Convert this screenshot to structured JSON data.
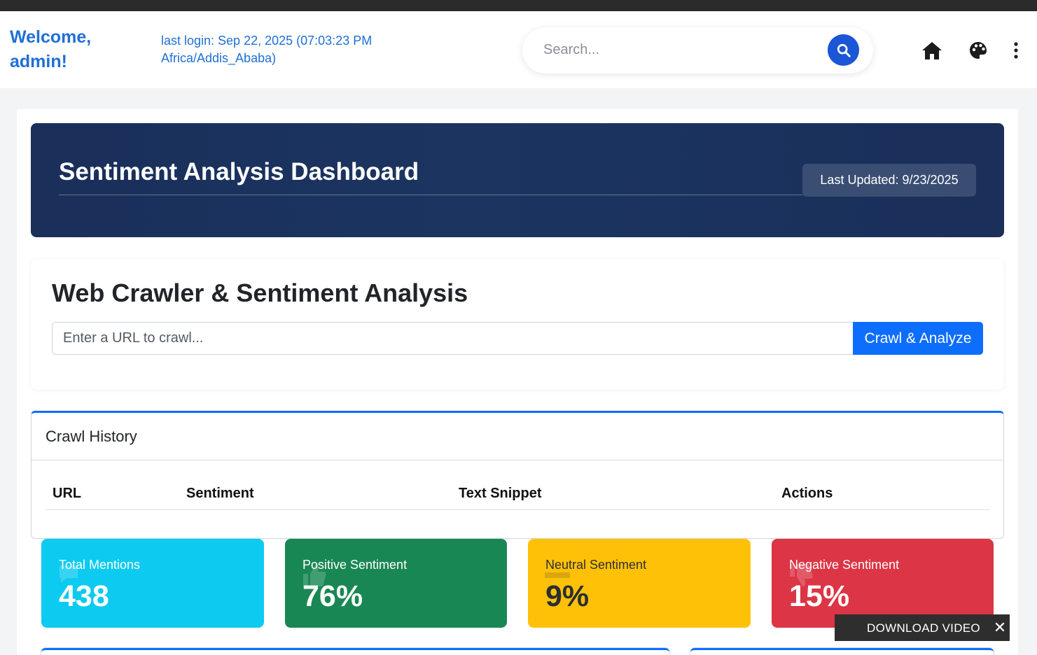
{
  "header": {
    "welcome": "Welcome, admin!",
    "last_login": "last login: Sep 22, 2025 (07:03:23 PM Africa/Addis_Ababa)",
    "search_placeholder": "Search...",
    "icons": [
      "search-icon",
      "home-icon",
      "palette-icon",
      "kebab-menu-icon"
    ]
  },
  "hero": {
    "title": "Sentiment Analysis Dashboard",
    "last_updated": "Last Updated: 9/23/2025"
  },
  "crawler": {
    "title": "Web Crawler & Sentiment Analysis",
    "url_placeholder": "Enter a URL to crawl...",
    "button": "Crawl & Analyze"
  },
  "history": {
    "title": "Crawl History",
    "columns": [
      "URL",
      "Sentiment",
      "Text Snippet",
      "Actions"
    ],
    "rows": []
  },
  "stats": [
    {
      "label": "Total Mentions",
      "value": "438",
      "color": "#0dcaf0"
    },
    {
      "label": "Positive Sentiment",
      "value": "76%",
      "color": "#198754"
    },
    {
      "label": "Neutral Sentiment",
      "value": "9%",
      "color": "#ffc107"
    },
    {
      "label": "Negative Sentiment",
      "value": "15%",
      "color": "#dc3545"
    }
  ],
  "download_bar": {
    "label": "DOWNLOAD VIDEO",
    "close": "✕"
  },
  "colors": {
    "accent": "#1f6fd6",
    "primary": "#0d6efd",
    "hero_bg": "#1a2f5a"
  }
}
